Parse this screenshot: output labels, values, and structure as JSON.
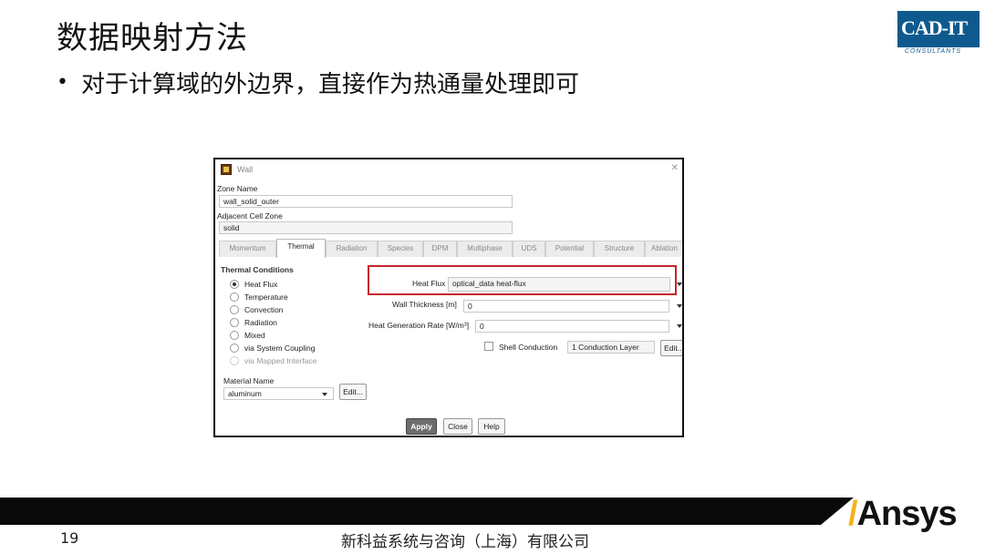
{
  "slide": {
    "title": "数据映射方法",
    "bullet": "对于计算域的外边界，直接作为热通量处理即可",
    "page_number": "19",
    "footer": "新科益系统与咨询（上海）有限公司"
  },
  "logo": {
    "main": "CAD-IT",
    "sub": "CONSULTANTS"
  },
  "brand": {
    "name": "Ansys",
    "accent": "#f2b41b",
    "bar_color": "#0a0a0a"
  },
  "dialog": {
    "title": "Wall",
    "zone_name_label": "Zone Name",
    "zone_name_value": "wall_solid_outer",
    "adjacent_label": "Adjacent Cell Zone",
    "adjacent_value": "solid",
    "tabs": [
      "Momentum",
      "Thermal",
      "Radiation",
      "Species",
      "DPM",
      "Multiphase",
      "UDS",
      "Potential",
      "Structure",
      "Ablation"
    ],
    "active_tab": "Thermal",
    "thermal": {
      "section_title": "Thermal Conditions",
      "options": [
        "Heat Flux",
        "Temperature",
        "Convection",
        "Radiation",
        "Mixed",
        "via System Coupling",
        "via Mapped Interface"
      ],
      "selected": "Heat Flux",
      "heat_flux_label": "Heat Flux",
      "heat_flux_value": "optical_data heat-flux",
      "wall_thickness_label": "Wall Thickness [m]",
      "wall_thickness_value": "0",
      "heat_gen_label": "Heat Generation Rate [W/m³]",
      "heat_gen_value": "0",
      "shell_conduction_label": "Shell Conduction",
      "conduction_layers": "1 Conduction Layer",
      "edit_label": "Edit..."
    },
    "material": {
      "label": "Material Name",
      "value": "aluminum",
      "edit_label": "Edit..."
    },
    "buttons": {
      "apply": "Apply",
      "close": "Close",
      "help": "Help"
    },
    "highlight_color": "#c4262e"
  }
}
